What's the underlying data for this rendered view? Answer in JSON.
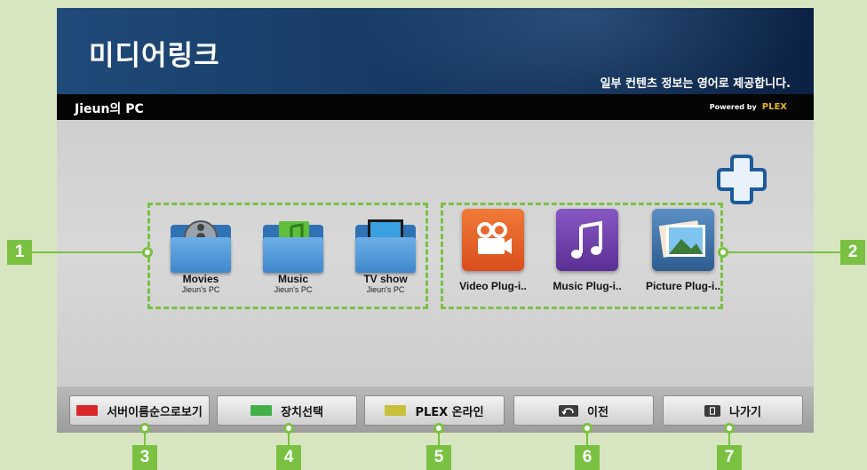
{
  "header": {
    "title": "미디어링크",
    "info_note": "일부 컨텐츠 정보는 영어로 제공합니다.",
    "device_name": "Jieun의 PC",
    "powered_by_label": "Powered by",
    "powered_by_brand": "PLEX"
  },
  "library_tiles": [
    {
      "name": "Movies",
      "sub": "Jieun's PC",
      "icon": "movie-folder-icon"
    },
    {
      "name": "Music",
      "sub": "Jieun's PC",
      "icon": "music-folder-icon"
    },
    {
      "name": "TV show",
      "sub": "Jieun's PC",
      "icon": "tv-folder-icon"
    }
  ],
  "plugin_tiles": [
    {
      "name": "Video Plug-i..",
      "icon": "video-camera-icon",
      "color": "#e8642a"
    },
    {
      "name": "Music Plug-i..",
      "icon": "music-note-icon",
      "color": "#6b3fa6"
    },
    {
      "name": "Picture Plug-i..",
      "icon": "picture-icon",
      "color": "#3b6c9e"
    }
  ],
  "function_buttons": [
    {
      "label": "서버이름순으로보기",
      "swatch": "#d9262b"
    },
    {
      "label": "장치선택",
      "swatch": "#43b049"
    },
    {
      "label": "PLEX 온라인",
      "swatch": "#c9bf3b"
    },
    {
      "label": "이전",
      "icon": "back-icon"
    },
    {
      "label": "나가기",
      "icon": "exit-icon"
    }
  ],
  "callouts": [
    "1",
    "2",
    "3",
    "4",
    "5",
    "6",
    "7"
  ],
  "colors": {
    "callout_green": "#7ac142",
    "header_blue": "#173c66"
  }
}
